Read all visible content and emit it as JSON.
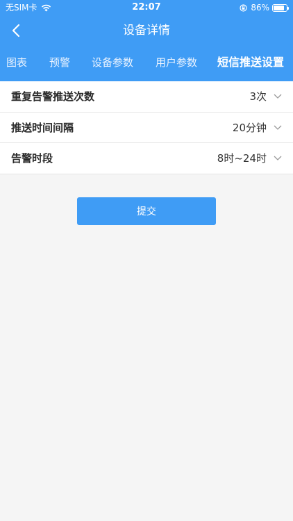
{
  "status_bar": {
    "carrier": "无SIM卡",
    "time": "22:07",
    "battery": "86%",
    "battery_level": 0.86
  },
  "nav": {
    "title": "设备详情"
  },
  "tabs": [
    {
      "label": "图表",
      "active": false
    },
    {
      "label": "预警",
      "active": false
    },
    {
      "label": "设备参数",
      "active": false
    },
    {
      "label": "用户参数",
      "active": false
    },
    {
      "label": "短信推送设置",
      "active": true
    }
  ],
  "settings": [
    {
      "label": "重复告警推送次数",
      "value": "3次"
    },
    {
      "label": "推送时间间隔",
      "value": "20分钟"
    },
    {
      "label": "告警时段",
      "value": "8时~24时"
    }
  ],
  "submit_label": "提交",
  "colors": {
    "primary": "#3f9cf5",
    "background": "#f5f5f5"
  },
  "icons": {
    "back": "chevron-left-icon",
    "dropdown": "chevron-down-icon",
    "wifi": "wifi-icon",
    "lock": "orientation-lock-icon",
    "battery": "battery-icon"
  }
}
